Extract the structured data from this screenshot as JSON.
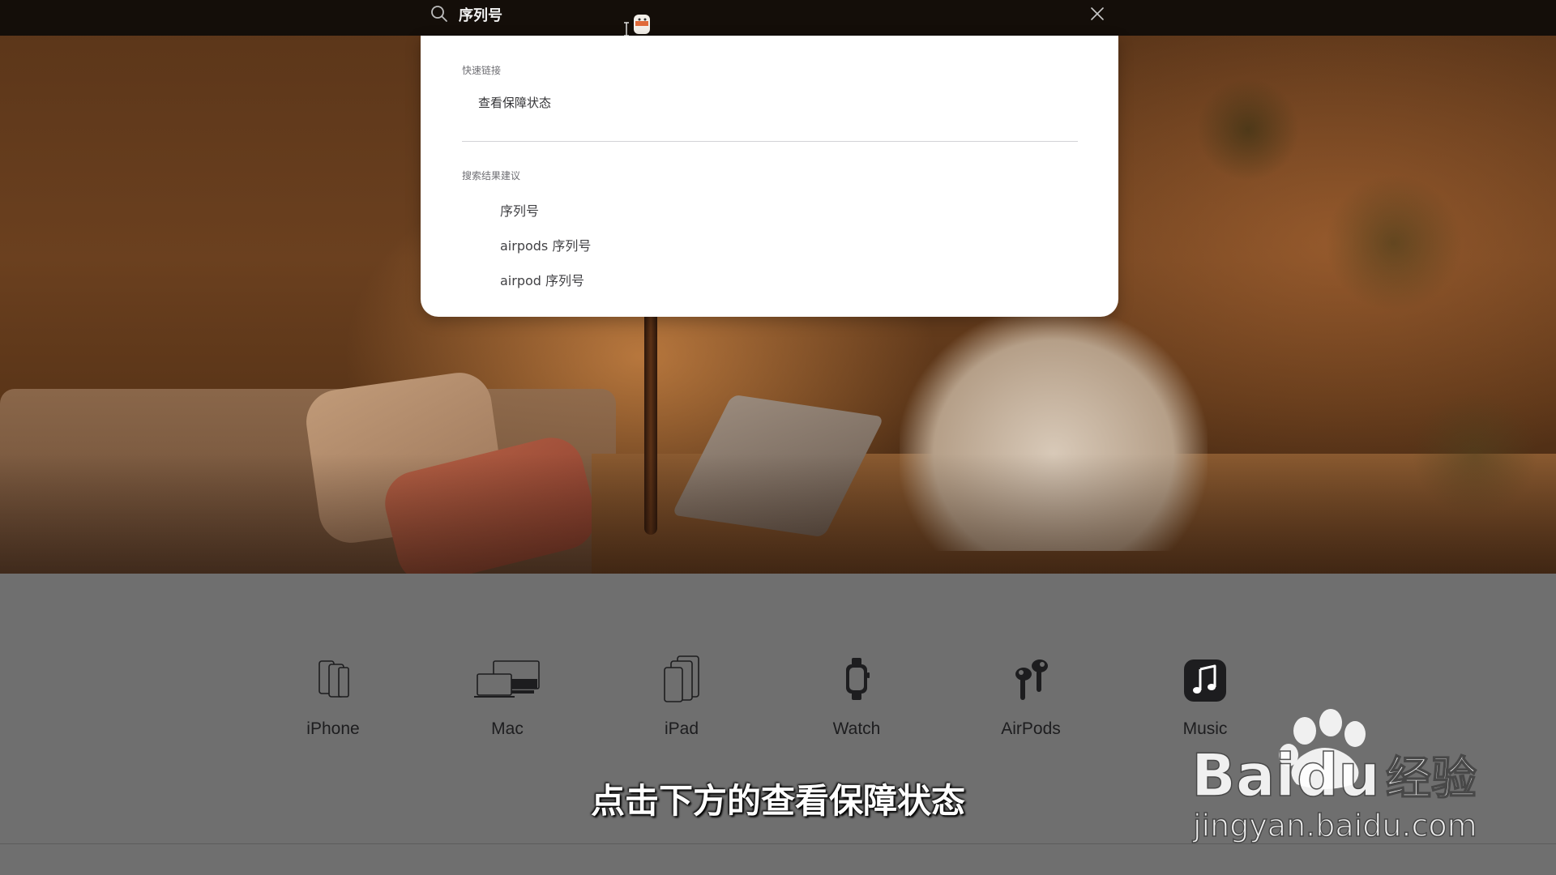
{
  "search": {
    "query": "序列号"
  },
  "dropdown": {
    "quick_links_title": "快速链接",
    "quick_links": [
      "查看保障状态"
    ],
    "suggestions_title": "搜索结果建议",
    "suggestions": [
      "序列号",
      "airpods 序列号",
      "airpod 序列号"
    ]
  },
  "products": [
    {
      "label": "iPhone",
      "icon": "iphone-icon"
    },
    {
      "label": "Mac",
      "icon": "mac-icon"
    },
    {
      "label": "iPad",
      "icon": "ipad-icon"
    },
    {
      "label": "Watch",
      "icon": "watch-icon"
    },
    {
      "label": "AirPods",
      "icon": "airpods-icon"
    },
    {
      "label": "Music",
      "icon": "music-icon"
    }
  ],
  "subtitle": "点击下方的查看保障状态",
  "watermark": {
    "brand": "Baidu经验",
    "url": "jingyan.baidu.com"
  },
  "colors": {
    "topbar": "#140e09",
    "dropdown_bg": "#ffffff",
    "product_band": "#6f6f6f",
    "text_dark": "#1d1d1f"
  }
}
